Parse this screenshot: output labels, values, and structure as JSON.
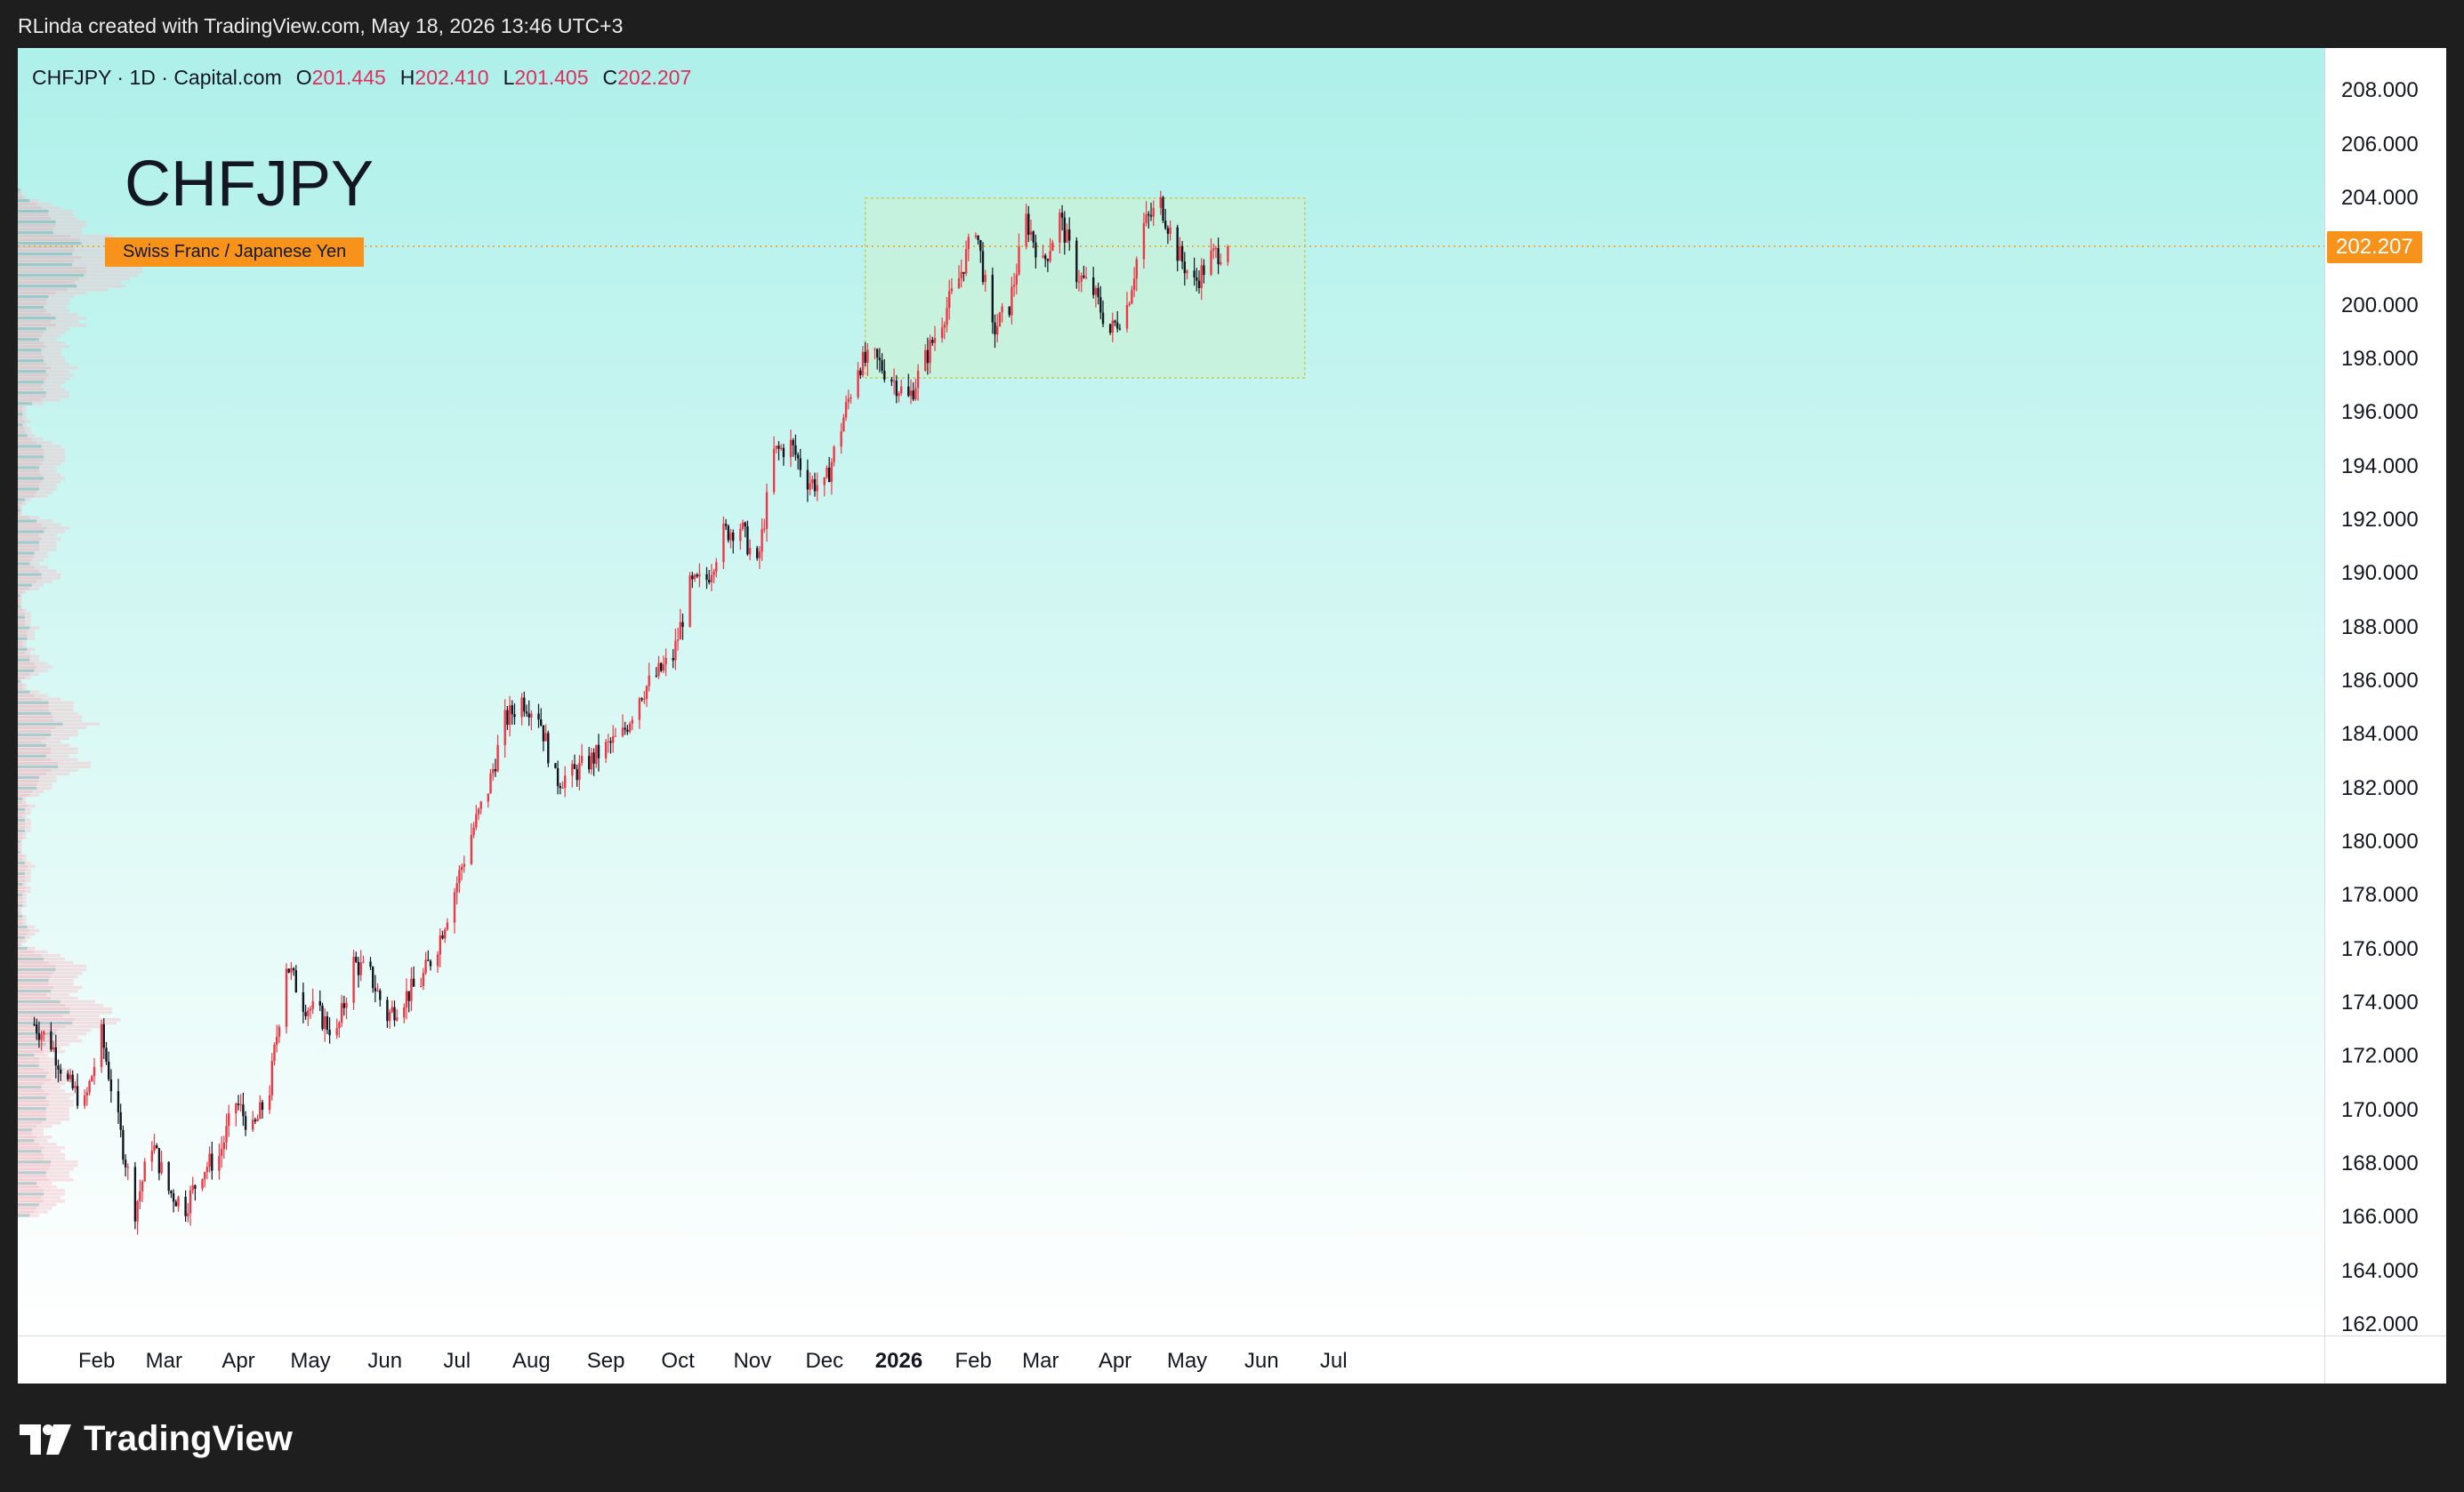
{
  "header": {
    "caption": "RLinda created with TradingView.com, May 18, 2026 13:46 UTC+3"
  },
  "legend": {
    "symbol_line": "CHFJPY · 1D · Capital.com",
    "open_label": "O",
    "open_value": "201.445",
    "high_label": "H",
    "high_value": "202.410",
    "low_label": "L",
    "low_value": "201.405",
    "close_label": "C",
    "close_value": "202.207"
  },
  "watermark": {
    "symbol": "CHFJPY",
    "description": "Swiss Franc / Japanese Yen"
  },
  "last_price_tag": "202.207",
  "footer": {
    "brand": "TradingView"
  },
  "colors": {
    "up_candle": "#f23645",
    "down_candle": "#131722",
    "last_price_tag": "#f7931a",
    "range_box_fill": "#c8f2d8",
    "range_box_border": "#c8c85a",
    "background_top": "#aef0ea",
    "background_bottom": "#ffffff"
  },
  "chart_data": {
    "type": "candlestick",
    "symbol": "CHFJPY",
    "interval": "1D",
    "source": "Capital.com",
    "y_axis": {
      "ylim": [
        161.6,
        209.6
      ],
      "tick_labels": [
        "162.000",
        "164.000",
        "166.000",
        "168.000",
        "170.000",
        "172.000",
        "174.000",
        "176.000",
        "178.000",
        "180.000",
        "182.000",
        "184.000",
        "186.000",
        "188.000",
        "190.000",
        "192.000",
        "194.000",
        "196.000",
        "198.000",
        "200.000",
        "202.000",
        "204.000",
        "206.000",
        "208.000"
      ]
    },
    "x_axis": {
      "tick_labels": [
        {
          "label": "Feb",
          "date": "2025-02-01",
          "bold": false
        },
        {
          "label": "Mar",
          "date": "2025-03-01",
          "bold": false
        },
        {
          "label": "Apr",
          "date": "2025-04-01",
          "bold": false
        },
        {
          "label": "May",
          "date": "2025-05-01",
          "bold": false
        },
        {
          "label": "Jun",
          "date": "2025-06-01",
          "bold": false
        },
        {
          "label": "Jul",
          "date": "2025-07-01",
          "bold": false
        },
        {
          "label": "Aug",
          "date": "2025-08-01",
          "bold": false
        },
        {
          "label": "Sep",
          "date": "2025-09-01",
          "bold": false
        },
        {
          "label": "Oct",
          "date": "2025-10-01",
          "bold": false
        },
        {
          "label": "Nov",
          "date": "2025-11-01",
          "bold": false
        },
        {
          "label": "Dec",
          "date": "2025-12-01",
          "bold": false
        },
        {
          "label": "2026",
          "date": "2026-01-01",
          "bold": true
        },
        {
          "label": "Feb",
          "date": "2026-02-01",
          "bold": false
        },
        {
          "label": "Mar",
          "date": "2026-03-01",
          "bold": false
        },
        {
          "label": "Apr",
          "date": "2026-04-01",
          "bold": false
        },
        {
          "label": "May",
          "date": "2026-05-01",
          "bold": false
        },
        {
          "label": "Jun",
          "date": "2026-06-01",
          "bold": false
        },
        {
          "label": "Jul",
          "date": "2026-07-01",
          "bold": false
        }
      ]
    },
    "last_price": 202.207,
    "range_box": {
      "from": "2025-12-18",
      "to": "2026-06-19",
      "low": 197.3,
      "high": 204.0
    },
    "price_path": [
      [
        "2025-01-06",
        173.2
      ],
      [
        "2025-01-13",
        172.5
      ],
      [
        "2025-01-20",
        171.0
      ],
      [
        "2025-01-27",
        170.2
      ],
      [
        "2025-02-03",
        172.8
      ],
      [
        "2025-02-10",
        169.5
      ],
      [
        "2025-02-17",
        166.3
      ],
      [
        "2025-02-24",
        168.8
      ],
      [
        "2025-03-03",
        167.0
      ],
      [
        "2025-03-10",
        166.4
      ],
      [
        "2025-03-17",
        167.8
      ],
      [
        "2025-03-24",
        168.3
      ],
      [
        "2025-03-31",
        170.3
      ],
      [
        "2025-04-07",
        169.2
      ],
      [
        "2025-04-14",
        170.8
      ],
      [
        "2025-04-21",
        175.5
      ],
      [
        "2025-04-28",
        174.0
      ],
      [
        "2025-05-05",
        173.5
      ],
      [
        "2025-05-12",
        172.8
      ],
      [
        "2025-05-19",
        175.5
      ],
      [
        "2025-05-26",
        175.0
      ],
      [
        "2025-06-02",
        173.5
      ],
      [
        "2025-06-09",
        174.2
      ],
      [
        "2025-06-16",
        174.8
      ],
      [
        "2025-06-23",
        176.2
      ],
      [
        "2025-06-30",
        178.2
      ],
      [
        "2025-07-07",
        180.3
      ],
      [
        "2025-07-14",
        182.0
      ],
      [
        "2025-07-21",
        184.5
      ],
      [
        "2025-07-28",
        185.3
      ],
      [
        "2025-08-04",
        184.8
      ],
      [
        "2025-08-11",
        182.3
      ],
      [
        "2025-08-18",
        182.5
      ],
      [
        "2025-08-25",
        183.0
      ],
      [
        "2025-09-01",
        183.5
      ],
      [
        "2025-09-08",
        184.0
      ],
      [
        "2025-09-15",
        185.5
      ],
      [
        "2025-09-22",
        186.2
      ],
      [
        "2025-09-29",
        186.9
      ],
      [
        "2025-10-06",
        189.5
      ],
      [
        "2025-10-13",
        189.8
      ],
      [
        "2025-10-20",
        191.5
      ],
      [
        "2025-10-27",
        191.8
      ],
      [
        "2025-11-03",
        190.2
      ],
      [
        "2025-11-10",
        194.5
      ],
      [
        "2025-11-17",
        194.8
      ],
      [
        "2025-11-24",
        193.5
      ],
      [
        "2025-12-01",
        193.2
      ],
      [
        "2025-12-08",
        195.5
      ],
      [
        "2025-12-15",
        197.8
      ],
      [
        "2025-12-22",
        198.0
      ],
      [
        "2025-12-29",
        197.3
      ],
      [
        "2026-01-05",
        196.5
      ],
      [
        "2026-01-12",
        198.0
      ],
      [
        "2026-01-19",
        199.5
      ],
      [
        "2026-01-26",
        201.0
      ],
      [
        "2026-02-02",
        203.0
      ],
      [
        "2026-02-09",
        199.0
      ],
      [
        "2026-02-16",
        200.0
      ],
      [
        "2026-02-23",
        203.2
      ],
      [
        "2026-03-02",
        201.5
      ],
      [
        "2026-03-09",
        203.3
      ],
      [
        "2026-03-16",
        201.2
      ],
      [
        "2026-03-23",
        200.5
      ],
      [
        "2026-03-30",
        199.0
      ],
      [
        "2026-04-06",
        200.0
      ],
      [
        "2026-04-13",
        203.0
      ],
      [
        "2026-04-20",
        203.8
      ],
      [
        "2026-04-27",
        202.0
      ],
      [
        "2026-05-04",
        200.8
      ],
      [
        "2026-05-11",
        201.8
      ],
      [
        "2026-05-18",
        202.207
      ]
    ]
  }
}
